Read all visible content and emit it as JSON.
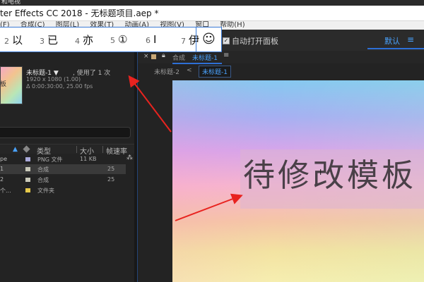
{
  "window": {
    "topcut_text": "和电视",
    "title": "ter Effects CC 2018 - 无标题项目.aep *"
  },
  "menubar": {
    "items": [
      "(F)",
      "合成(C)",
      "图层(L)",
      "效果(T)",
      "动画(A)",
      "视图(V)",
      "窗口",
      "帮助(H)"
    ]
  },
  "ime": {
    "candidates": [
      {
        "num": "2",
        "char": "以"
      },
      {
        "num": "3",
        "char": "已"
      },
      {
        "num": "4",
        "char": "亦"
      },
      {
        "num": "5",
        "char": "①"
      },
      {
        "num": "6",
        "char": "I"
      },
      {
        "num": "7",
        "char": "伊"
      }
    ],
    "emoji_icon": "smiley-face-icon"
  },
  "toolbar": {
    "auto_open_label": "自动打开面板",
    "auto_open_checked": true,
    "workspace_label": "默认",
    "menu_icon": "≡"
  },
  "project": {
    "comp_name": "未标题-1 ▼",
    "used": ", 使用了 1 次",
    "resolution": "1920 x 1080 (1.00)",
    "duration": "Δ 0:00:30:00, 25.00 fps",
    "thumb_text": "板",
    "columns": {
      "type": "类型",
      "size": "大小",
      "fps": "帧速率"
    },
    "rows": [
      {
        "name": "pe",
        "label_color": "#a9a9d9",
        "type": "PNG 文件",
        "size": "11 KB",
        "fps": "",
        "selected": false
      },
      {
        "name": "1",
        "label_color": "#c9c9b9",
        "type": "合成",
        "size": "",
        "fps": "25",
        "selected": true
      },
      {
        "name": "2",
        "label_color": "#c9c9b9",
        "type": "合成",
        "size": "",
        "fps": "25",
        "selected": false
      },
      {
        "name": "个...",
        "label_color": "#e5c84a",
        "type": "文件夹",
        "size": "",
        "fps": "",
        "selected": false
      }
    ]
  },
  "comp_panel": {
    "tab_label": "合成",
    "tab_name": "未标题-1",
    "breadcrumb_parent": "未标题-2",
    "breadcrumb_sep": "<",
    "breadcrumb_current": "未标题-1",
    "viewer_text": "待修改模板"
  },
  "colors": {
    "accent": "#4aa3ff",
    "arrow": "#e8231f",
    "ime_border": "#3b7bd6"
  }
}
